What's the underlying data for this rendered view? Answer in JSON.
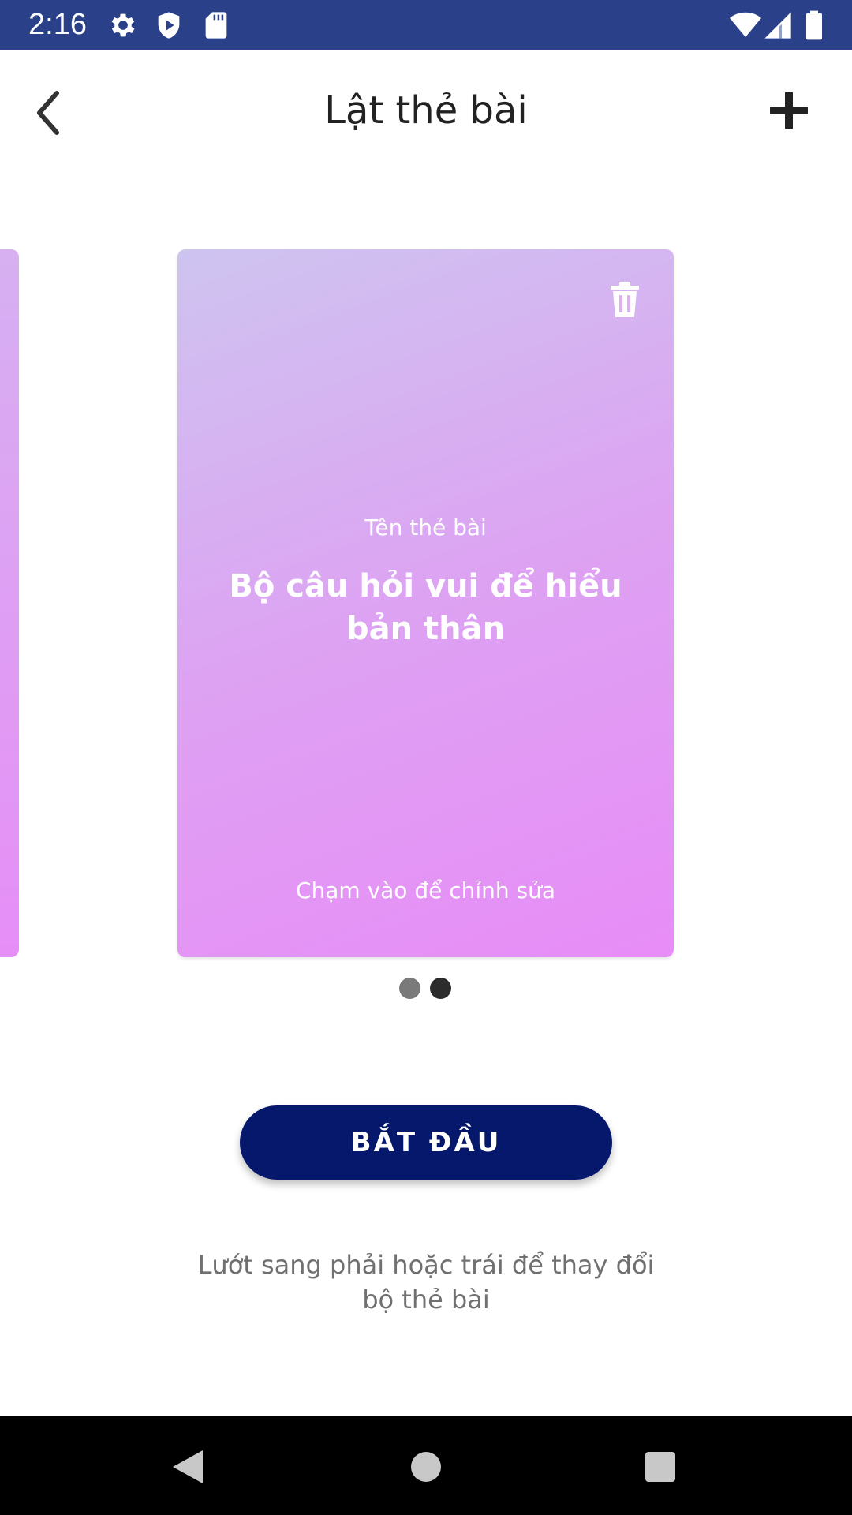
{
  "status_bar": {
    "time": "2:16",
    "icons_left": [
      "gear-icon",
      "shield-play-icon",
      "sd-card-icon"
    ],
    "icons_right": [
      "wifi-icon",
      "signal-icon",
      "battery-icon"
    ]
  },
  "header": {
    "title": "Lật thẻ bài",
    "back_icon": "chevron-left-icon",
    "add_icon": "plus-icon"
  },
  "card": {
    "caption": "Tên thẻ bài",
    "title": "Bộ câu hỏi vui để hiểu bản thân",
    "hint": "Chạm vào để chỉnh sửa",
    "delete_icon": "trash-icon",
    "gradient_start": "#cec4f0",
    "gradient_end": "#e88cf7"
  },
  "pager": {
    "count": 2,
    "active_index": 1,
    "inactive_color": "#7a7a7a",
    "active_color": "#2c2c2c"
  },
  "start_button": {
    "label": "BẮT ĐẦU",
    "color": "#06186c"
  },
  "swipe_hint": "Lướt sang phải hoặc trái để thay đổi bộ thẻ bài",
  "colors": {
    "status_bar": "#2a4189",
    "nav_bar": "#000000"
  }
}
